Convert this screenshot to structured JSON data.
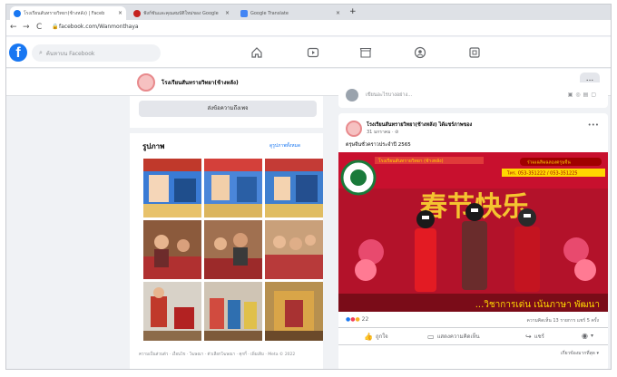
{
  "browser": {
    "tabs": [
      {
        "label": "โรงเรียนสันทรายวิทยา(ช้างหลัง) | Faceb",
        "active": true,
        "favicon_color": "#1877f2"
      },
      {
        "label": "ฟังก์ชันและคุณสมบัติใหม่ของ Google",
        "active": false,
        "favicon_color": "#c5221f"
      },
      {
        "label": "Google Translate",
        "active": false,
        "favicon_color": "#4285f4"
      }
    ],
    "tab_close": "×",
    "new_tab": "+",
    "back": "←",
    "forward": "→",
    "reload": "C",
    "lock": "🔒",
    "url": "facebook.com/Wanmonthaya"
  },
  "facebook": {
    "logo": "f",
    "search_placeholder": "ค้นหาบน Facebook",
    "nav_icons": [
      "home-icon",
      "watch-icon",
      "marketplace-icon",
      "groups-icon",
      "gaming-icon"
    ]
  },
  "page": {
    "name": "โรงเรียนสันทรายวิทยา(ช้างหลัง)",
    "more": "...",
    "message_button": "ส่งข้อความถึงเพจ",
    "photos_title": "รูปภาพ",
    "photos_see_all": "ดูรูปภาพทั้งหมด",
    "footer": "ความเป็นส่วนตัว · เงื่อนไข · โฆษณา · ตัวเลือกโฆษณา · คุกกี้ · เพิ่มเติม · Meta © 2022"
  },
  "composer": {
    "placeholder": "เขียนอะไรบางอย่าง..."
  },
  "post": {
    "author": "โรงเรียนสันทรายวิทยา(ช้างหลัง) ได้แชร์ภาพของ",
    "time": "31 มกราคม · ⊘",
    "caption": "ตรุษจีนชั่วคราวประจำปี 2565",
    "banner_school": "โรงเรียนสันทรายวิทยา (ช้างหลัง)",
    "banner_right": "ร่วมเฉลิมฉลองตรุษจีน",
    "banner_phones": "โทร. 053-351222 / 053-351225",
    "chinese_text": "春节快乐",
    "bottom_text": "...วิชาการเด่น เน้นภาษา พัฒนา",
    "reactions_count": "22",
    "stats": "ความคิดเห็น 13 รายการ แชร์ 5 ครั้ง",
    "actions": {
      "like": "ถูกใจ",
      "comment": "แสดงความคิดเห็น",
      "share": "แชร์"
    },
    "relevant": "เกี่ยวข้องมากที่สุด ▾"
  },
  "colors": {
    "fb_blue": "#1877f2",
    "banner_red": "#c8102e",
    "banner_gold": "#ffd700"
  }
}
